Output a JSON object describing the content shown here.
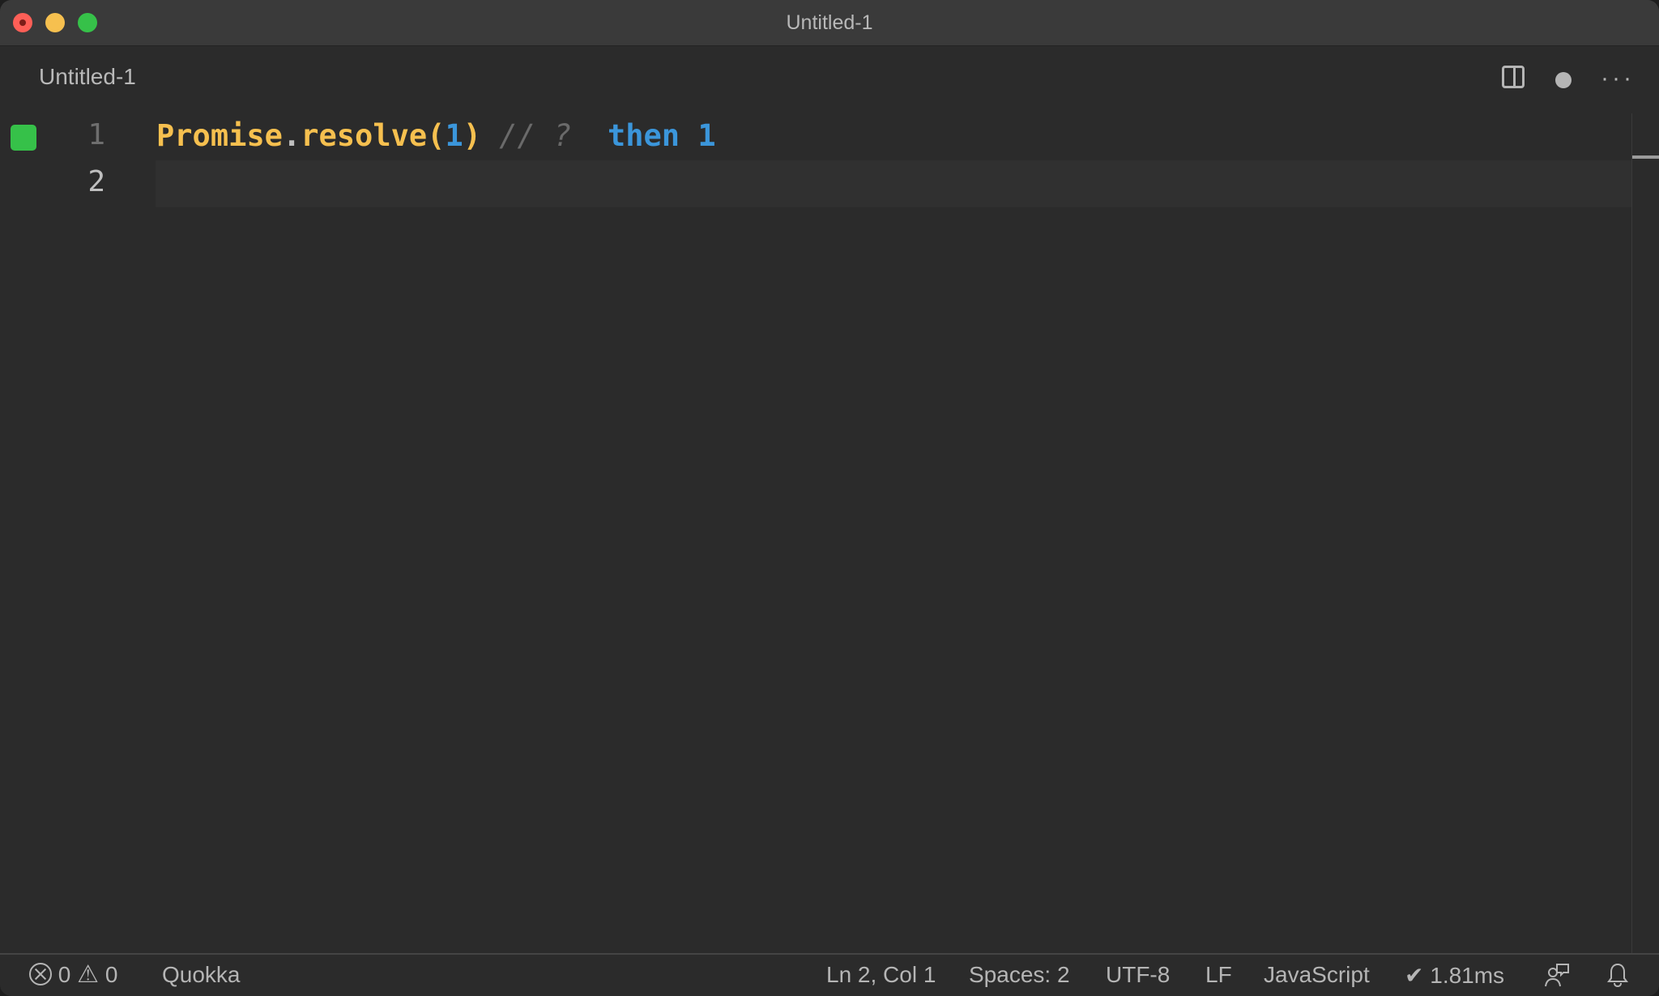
{
  "window": {
    "title": "Untitled-1"
  },
  "tab": {
    "label": "Untitled-1",
    "actions": {
      "split": "split-editor-icon",
      "dirty": "unsaved-dot-icon",
      "more": "···"
    }
  },
  "editor": {
    "lines": [
      {
        "number": "1",
        "tokens": {
          "ident": "Promise",
          "dot": ".",
          "method": "resolve",
          "open": "(",
          "arg": "1",
          "close": ")",
          "comment": " // ?",
          "inline": "  then 1"
        },
        "gutter_status": "covered"
      },
      {
        "number": "2",
        "tokens": {},
        "active": true
      }
    ],
    "colors": {
      "identifier": "#f6c04f",
      "number": "#3b96db",
      "comment": "#6a6a6a",
      "inline_result": "#3b96db",
      "gutter_covered": "#36c149"
    }
  },
  "statusbar": {
    "errors": "0",
    "warnings": "0",
    "extension": "Quokka",
    "cursor": "Ln 2, Col 1",
    "indent": "Spaces: 2",
    "encoding": "UTF-8",
    "eol": "LF",
    "language": "JavaScript",
    "quokka_time": "✔ 1.81ms"
  }
}
